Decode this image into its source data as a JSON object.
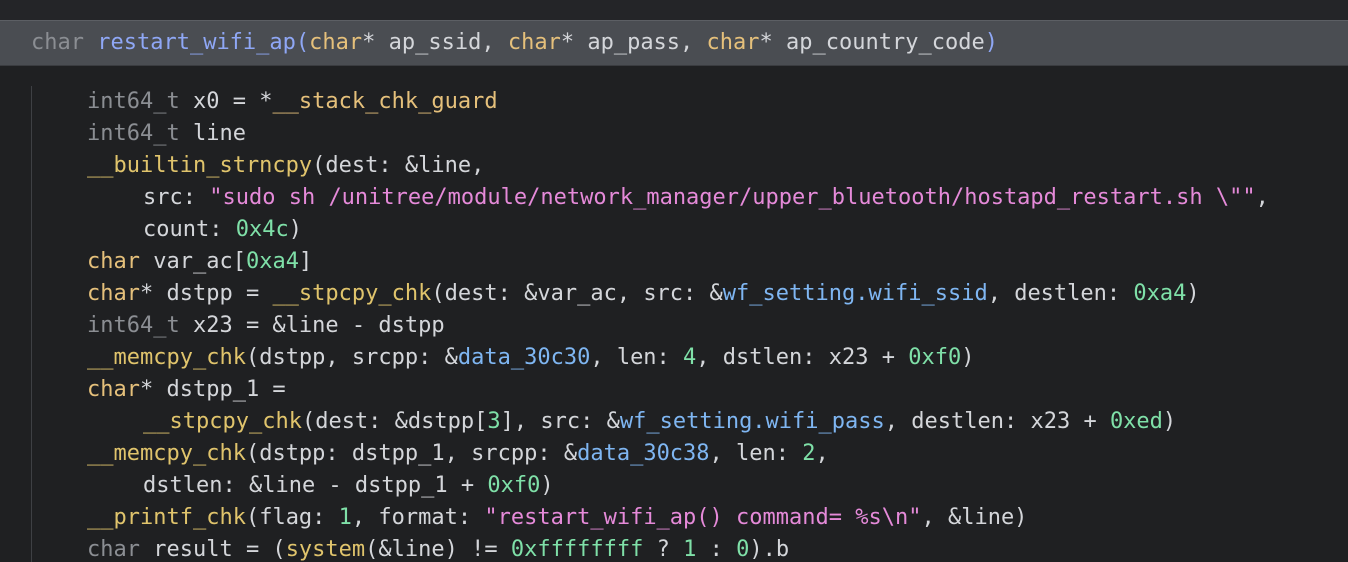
{
  "signature": {
    "return_type": "char",
    "name": "restart_wifi_ap",
    "open": "(",
    "p1_type": "char",
    "p1_rest": "* ap_ssid, ",
    "p2_type": "char",
    "p2_rest": "* ap_pass, ",
    "p3_type": "char",
    "p3_rest": "* ap_country_code",
    "close": ")"
  },
  "code": {
    "l1": {
      "type": "int64_t",
      "mid": " x0 = *",
      "glob": "__stack_chk_guard"
    },
    "l2": {
      "type": "int64_t",
      "mid": " line"
    },
    "l3": {
      "fn": "__builtin_strncpy",
      "rest": "(dest: &line,"
    },
    "l4": {
      "pre": "src: ",
      "str": "\"sudo sh /unitree/module/network_manager/upper_bluetooth/hostapd_restart.sh \\\"\"",
      "post": ","
    },
    "l5": {
      "pre": "count: ",
      "num": "0x4c",
      "post": ")"
    },
    "l6": {
      "type": "char",
      "mid": " var_ac[",
      "num": "0xa4",
      "post": "]"
    },
    "l7": {
      "type": "char",
      "a": "* dstpp = ",
      "fn": "__stpcpy_chk",
      "b": "(dest: &var_ac, src: &",
      "glob": "wf_setting.wifi_ssid",
      "c": ", destlen: ",
      "num": "0xa4",
      "d": ")"
    },
    "l8": {
      "type": "int64_t",
      "mid": " x23 = &line - dstpp"
    },
    "l9": {
      "fn": "__memcpy_chk",
      "a": "(dstpp, srcpp: &",
      "glob": "data_30c30",
      "b": ", len: ",
      "num1": "4",
      "c": ", dstlen: x23 + ",
      "num2": "0xf0",
      "d": ")"
    },
    "l10": {
      "type": "char",
      "mid": "* dstpp_1 ="
    },
    "l11": {
      "fn": "__stpcpy_chk",
      "a": "(dest: &dstpp[",
      "num1": "3",
      "b": "], src: &",
      "glob": "wf_setting.wifi_pass",
      "c": ", destlen: x23 + ",
      "num2": "0xed",
      "d": ")"
    },
    "l12": {
      "fn": "__memcpy_chk",
      "a": "(dstpp: dstpp_1, srcpp: &",
      "glob": "data_30c38",
      "b": ", len: ",
      "num": "2",
      "c": ","
    },
    "l13": {
      "a": "dstlen: &line - dstpp_1 + ",
      "num": "0xf0",
      "b": ")"
    },
    "l14": {
      "fn": "__printf_chk",
      "a": "(flag: ",
      "num": "1",
      "b": ", format: ",
      "str": "\"restart_wifi_ap() command= %s\\n\"",
      "c": ", &line)"
    },
    "l15": {
      "type": "char",
      "a": " result = (",
      "fn": "system",
      "b": "(&line) != ",
      "num1": "0xffffffff",
      "c": " ? ",
      "num2": "1",
      "d": " : ",
      "num3": "0",
      "e": ").b"
    }
  }
}
